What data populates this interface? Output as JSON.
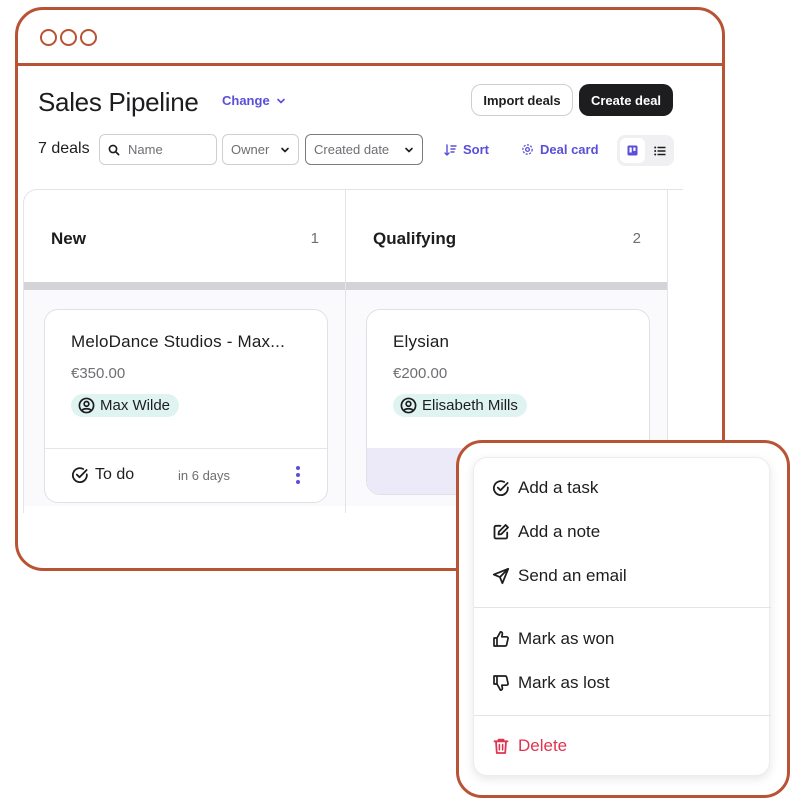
{
  "header": {
    "title": "Sales Pipeline",
    "change_label": "Change",
    "import_label": "Import deals",
    "create_label": "Create deal"
  },
  "toolbar": {
    "deal_count": "7 deals",
    "name_placeholder": "Name",
    "owner_label": "Owner",
    "created_label": "Created date",
    "sort_label": "Sort",
    "deal_card_label": "Deal card"
  },
  "columns": [
    {
      "title": "New",
      "count": "1",
      "card": {
        "title": "MeloDance Studios - Max...",
        "amount": "€350.00",
        "person": "Max Wilde",
        "task": "To do",
        "due": "in 6 days"
      }
    },
    {
      "title": "Qualifying",
      "count": "2",
      "card": {
        "title": "Elysian",
        "amount": "€200.00",
        "person": "Elisabeth Mills"
      }
    }
  ],
  "menu": {
    "items": [
      {
        "label": "Add a task",
        "icon": "check-circle-icon"
      },
      {
        "label": "Add a note",
        "icon": "edit-icon"
      },
      {
        "label": "Send an email",
        "icon": "send-icon"
      },
      {
        "label": "Mark as won",
        "icon": "thumbs-up-icon"
      },
      {
        "label": "Mark as lost",
        "icon": "thumbs-down-icon"
      },
      {
        "label": "Delete",
        "icon": "trash-icon"
      }
    ]
  },
  "colors": {
    "frame": "#b85434",
    "accent": "#5a4fd8",
    "danger": "#e0334f",
    "person_chip": "#dff4f1"
  }
}
